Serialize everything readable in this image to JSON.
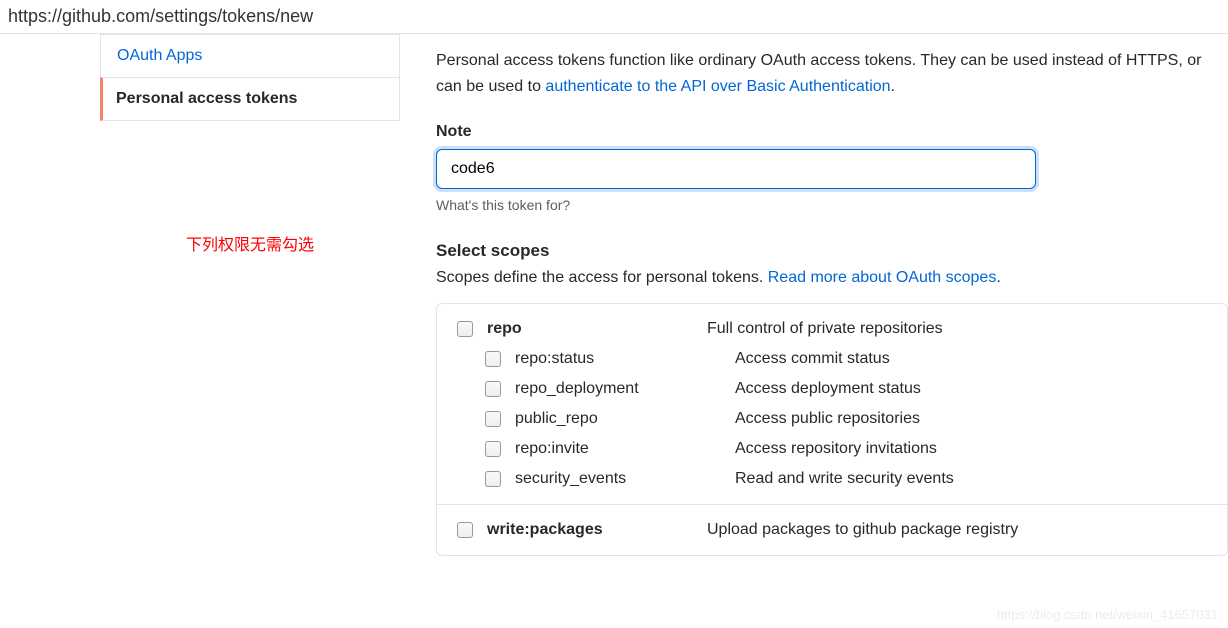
{
  "url": "https://github.com/settings/tokens/new",
  "sidebar": {
    "items": [
      {
        "label": "OAuth Apps"
      },
      {
        "label": "Personal access tokens"
      }
    ]
  },
  "annotation": "下列权限无需勾选",
  "intro": {
    "part1": "Personal access tokens function like ordinary OAuth access tokens. They can be used instead of HTTPS, or can be used to ",
    "link": "authenticate to the API over Basic Authentication",
    "part2": "."
  },
  "note": {
    "label": "Note",
    "value": "code6",
    "help": "What's this token for?"
  },
  "scopes": {
    "heading": "Select scopes",
    "desc_prefix": "Scopes define the access for personal tokens. ",
    "desc_link": "Read more about OAuth scopes",
    "desc_suffix": ".",
    "groups": [
      {
        "parent": {
          "name": "repo",
          "desc": "Full control of private repositories"
        },
        "children": [
          {
            "name": "repo:status",
            "desc": "Access commit status"
          },
          {
            "name": "repo_deployment",
            "desc": "Access deployment status"
          },
          {
            "name": "public_repo",
            "desc": "Access public repositories"
          },
          {
            "name": "repo:invite",
            "desc": "Access repository invitations"
          },
          {
            "name": "security_events",
            "desc": "Read and write security events"
          }
        ]
      },
      {
        "parent": {
          "name": "write:packages",
          "desc": "Upload packages to github package registry"
        },
        "children": []
      }
    ]
  },
  "watermark": "https://blog.csdn.net/weixin_41657031"
}
